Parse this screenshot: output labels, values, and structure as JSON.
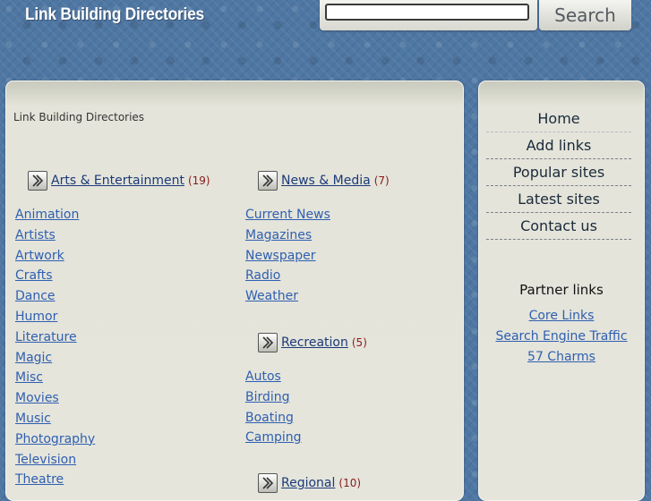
{
  "header": {
    "site_title": "Link Building Directories",
    "search_placeholder": "",
    "search_button": "Search"
  },
  "breadcrumb": "Link Building Directories",
  "categories": {
    "arts": {
      "title": "Arts & Entertainment",
      "count": "(19)",
      "links": [
        "Animation",
        "Artists",
        "Artwork",
        "Crafts",
        "Dance",
        "Humor",
        "Literature",
        "Magic",
        "Misc",
        "Movies",
        "Music",
        "Photography",
        "Television",
        "Theatre"
      ]
    },
    "news": {
      "title": "News & Media",
      "count": "(7)",
      "links": [
        "Current News",
        "Magazines",
        "Newspaper",
        "Radio",
        "Weather"
      ]
    },
    "recreation": {
      "title": "Recreation",
      "count": "(5)",
      "links": [
        "Autos",
        "Birding",
        "Boating",
        "Camping"
      ]
    },
    "regional": {
      "title": "Regional",
      "count": "(10)"
    }
  },
  "nav": {
    "items": [
      "Home",
      "Add links",
      "Popular sites",
      "Latest sites",
      "Contact us"
    ]
  },
  "partners": {
    "title": "Partner links",
    "links": [
      "Core Links",
      "Search Engine Traffic",
      "57 Charms"
    ]
  },
  "colors": {
    "background": "#4f77a3",
    "panel": "#e5e5dc",
    "link": "#2f5fb0",
    "count": "#8a1a1a"
  },
  "icons": {
    "category_arrow": "arrow-right-icon"
  }
}
